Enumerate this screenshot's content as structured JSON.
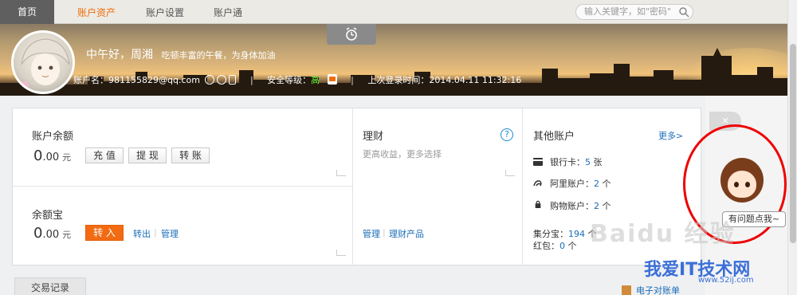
{
  "nav": {
    "tabs": [
      {
        "label": "首页"
      },
      {
        "label": "账户资产"
      },
      {
        "label": "账户设置"
      },
      {
        "label": "账户通"
      }
    ],
    "search_placeholder": "输入关键字，如\"密码\""
  },
  "banner": {
    "greeting": "中午好，周湘",
    "greeting_sub": "吃顿丰富的午餐，为身体加油",
    "account_label": "账户名：",
    "account_name": "981155829@qq.com",
    "security_label": "安全等级：",
    "security_level": "高",
    "last_login_label": "上次登录时间：",
    "last_login_time": "2014.04.11 11:32:16"
  },
  "balance": {
    "title": "账户余额",
    "amount_int": "0",
    "amount_dec": ".00",
    "unit": "元",
    "buttons": [
      "充 值",
      "提 现",
      "转 账"
    ]
  },
  "yuebao": {
    "title": "余额宝",
    "amount_int": "0",
    "amount_dec": ".00",
    "unit": "元",
    "transfer_in": "转 入",
    "transfer_out": "转出",
    "manage": "管理"
  },
  "finance": {
    "title": "理财",
    "subtitle": "更高收益，更多选择",
    "help": "?",
    "manage": "管理",
    "products": "理财产品"
  },
  "other": {
    "title": "其他账户",
    "more": "更多>",
    "bank_label": "银行卡：",
    "bank_count": "5",
    "bank_unit": "张",
    "ali_label": "阿里账户：",
    "ali_count": "2",
    "ali_unit": "个",
    "shop_label": "购物账户：",
    "shop_count": "2",
    "shop_unit": "个",
    "jifen_label": "集分宝：",
    "jifen_count": "194",
    "jifen_unit": "个",
    "hongbao_label": "红包：",
    "hongbao_count": "0",
    "hongbao_unit": "个"
  },
  "bottom": {
    "tab": "交易记录",
    "statement": "电子对账单"
  },
  "helper": {
    "close": "×",
    "bubble": "有问题点我~"
  },
  "watermark": {
    "baidu": "Baidu 经验",
    "site": "我爱IT技术网",
    "url": "www.52ij.com"
  },
  "colors": {
    "accent": "#f06d0c",
    "link": "#1a6db8",
    "security_high": "#6cff3a",
    "annotation": "#ee0000"
  }
}
